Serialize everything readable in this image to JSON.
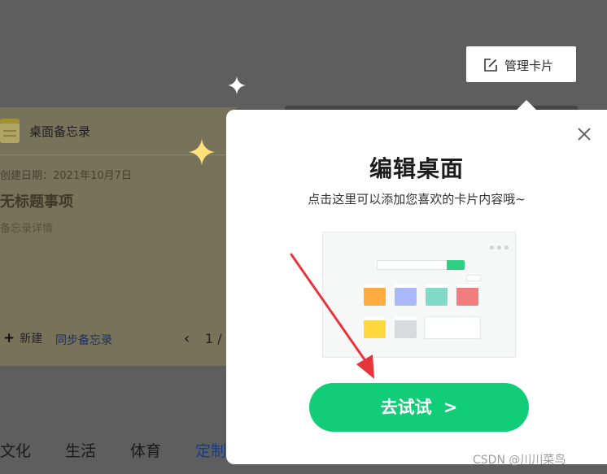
{
  "memo_card": {
    "title": "桌面备忘录",
    "date": "创建日期：2021年10月7日",
    "item_title": "无标题事项",
    "item_detail": "备忘录详情",
    "new_label": "新建",
    "new_icon": "plus-icon",
    "sync_label": "同步备忘录",
    "prev_icon": "chevron-left-icon",
    "page": "1 /"
  },
  "category_tabs": [
    {
      "label": "文化"
    },
    {
      "label": "生活"
    },
    {
      "label": "体育"
    },
    {
      "label": "定制"
    }
  ],
  "manage_button": {
    "label": "管理卡片",
    "icon": "edit-icon"
  },
  "popover": {
    "title": "编辑桌面",
    "subtitle": "点击这里可以添加您喜欢的卡片内容哦~",
    "close_icon": "close-icon",
    "try_label": "去试试",
    "try_chevron": ">"
  },
  "preview_tiles": [
    {
      "color": "#ffab40"
    },
    {
      "color": "#a9b8f8"
    },
    {
      "color": "#7fdbc8"
    },
    {
      "color": "#f37c7c"
    },
    {
      "color": "#ffd93d"
    },
    {
      "color": "#d8dbdd"
    }
  ],
  "colors": {
    "overlay": "#5e5e5e",
    "accent_green": "#12cd78",
    "arrow_red": "#e8353c",
    "sparkle_yellow": "#ffe07a"
  },
  "watermark": "CSDN @川川菜鸟"
}
